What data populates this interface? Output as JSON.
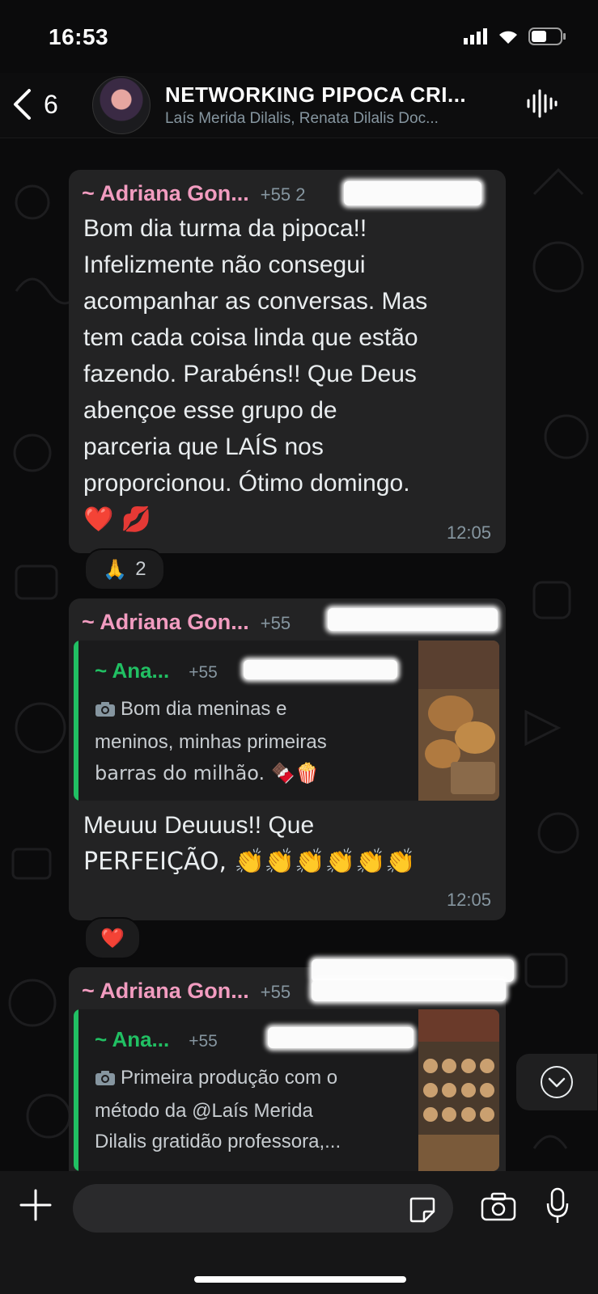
{
  "status_bar": {
    "time": "16:53"
  },
  "header": {
    "back_count": "6",
    "title": "NETWORKING PIPOCA CRI...",
    "subtitle": "Laís Merida Dilalis, Renata Dilalis Doc..."
  },
  "messages": [
    {
      "sender": "~ Adriana Gon...",
      "phone": "+55 2",
      "text_lines": [
        "Bom dia turma da pipoca!!",
        "Infelizmente não consegui",
        "acompanhar as conversas. Mas",
        "tem cada coisa linda que estão",
        "fazendo. Parabéns!! Que Deus",
        "abençoe esse grupo de",
        "parceria que LAÍS nos",
        "proporcionou. Ótimo domingo."
      ],
      "emojis": "❤️ 💋",
      "time": "12:05",
      "reaction": {
        "emoji": "🙏",
        "count": "2"
      }
    },
    {
      "sender": "~ Adriana Gon...",
      "phone": "+55",
      "quote": {
        "sender": "~ Ana...",
        "phone": "+55",
        "camera_icon": "camera-icon",
        "text_lines": [
          "Bom dia meninas e",
          "meninos,  minhas primeiras",
          "barras do milhão. 🍫🍿"
        ]
      },
      "text_lines": [
        "Meuuu Deuuus!! Que",
        "PERFEIÇÃO,  👏👏👏👏👏👏"
      ],
      "time": "12:05",
      "reaction": {
        "emoji": "❤️"
      }
    },
    {
      "sender": "~ Adriana Gon...",
      "phone": "+55",
      "quote": {
        "sender": "~ Ana...",
        "phone": "+55",
        "camera_icon": "camera-icon",
        "text_lines": [
          "Primeira produção  com o",
          "método da @Laís Merida",
          "Dilalis gratidão professora,..."
        ]
      }
    }
  ],
  "composer": {
    "placeholder": ""
  },
  "colors": {
    "sender": "#f29cc0",
    "quote_accent": "#21c063",
    "bubble": "#232324"
  }
}
